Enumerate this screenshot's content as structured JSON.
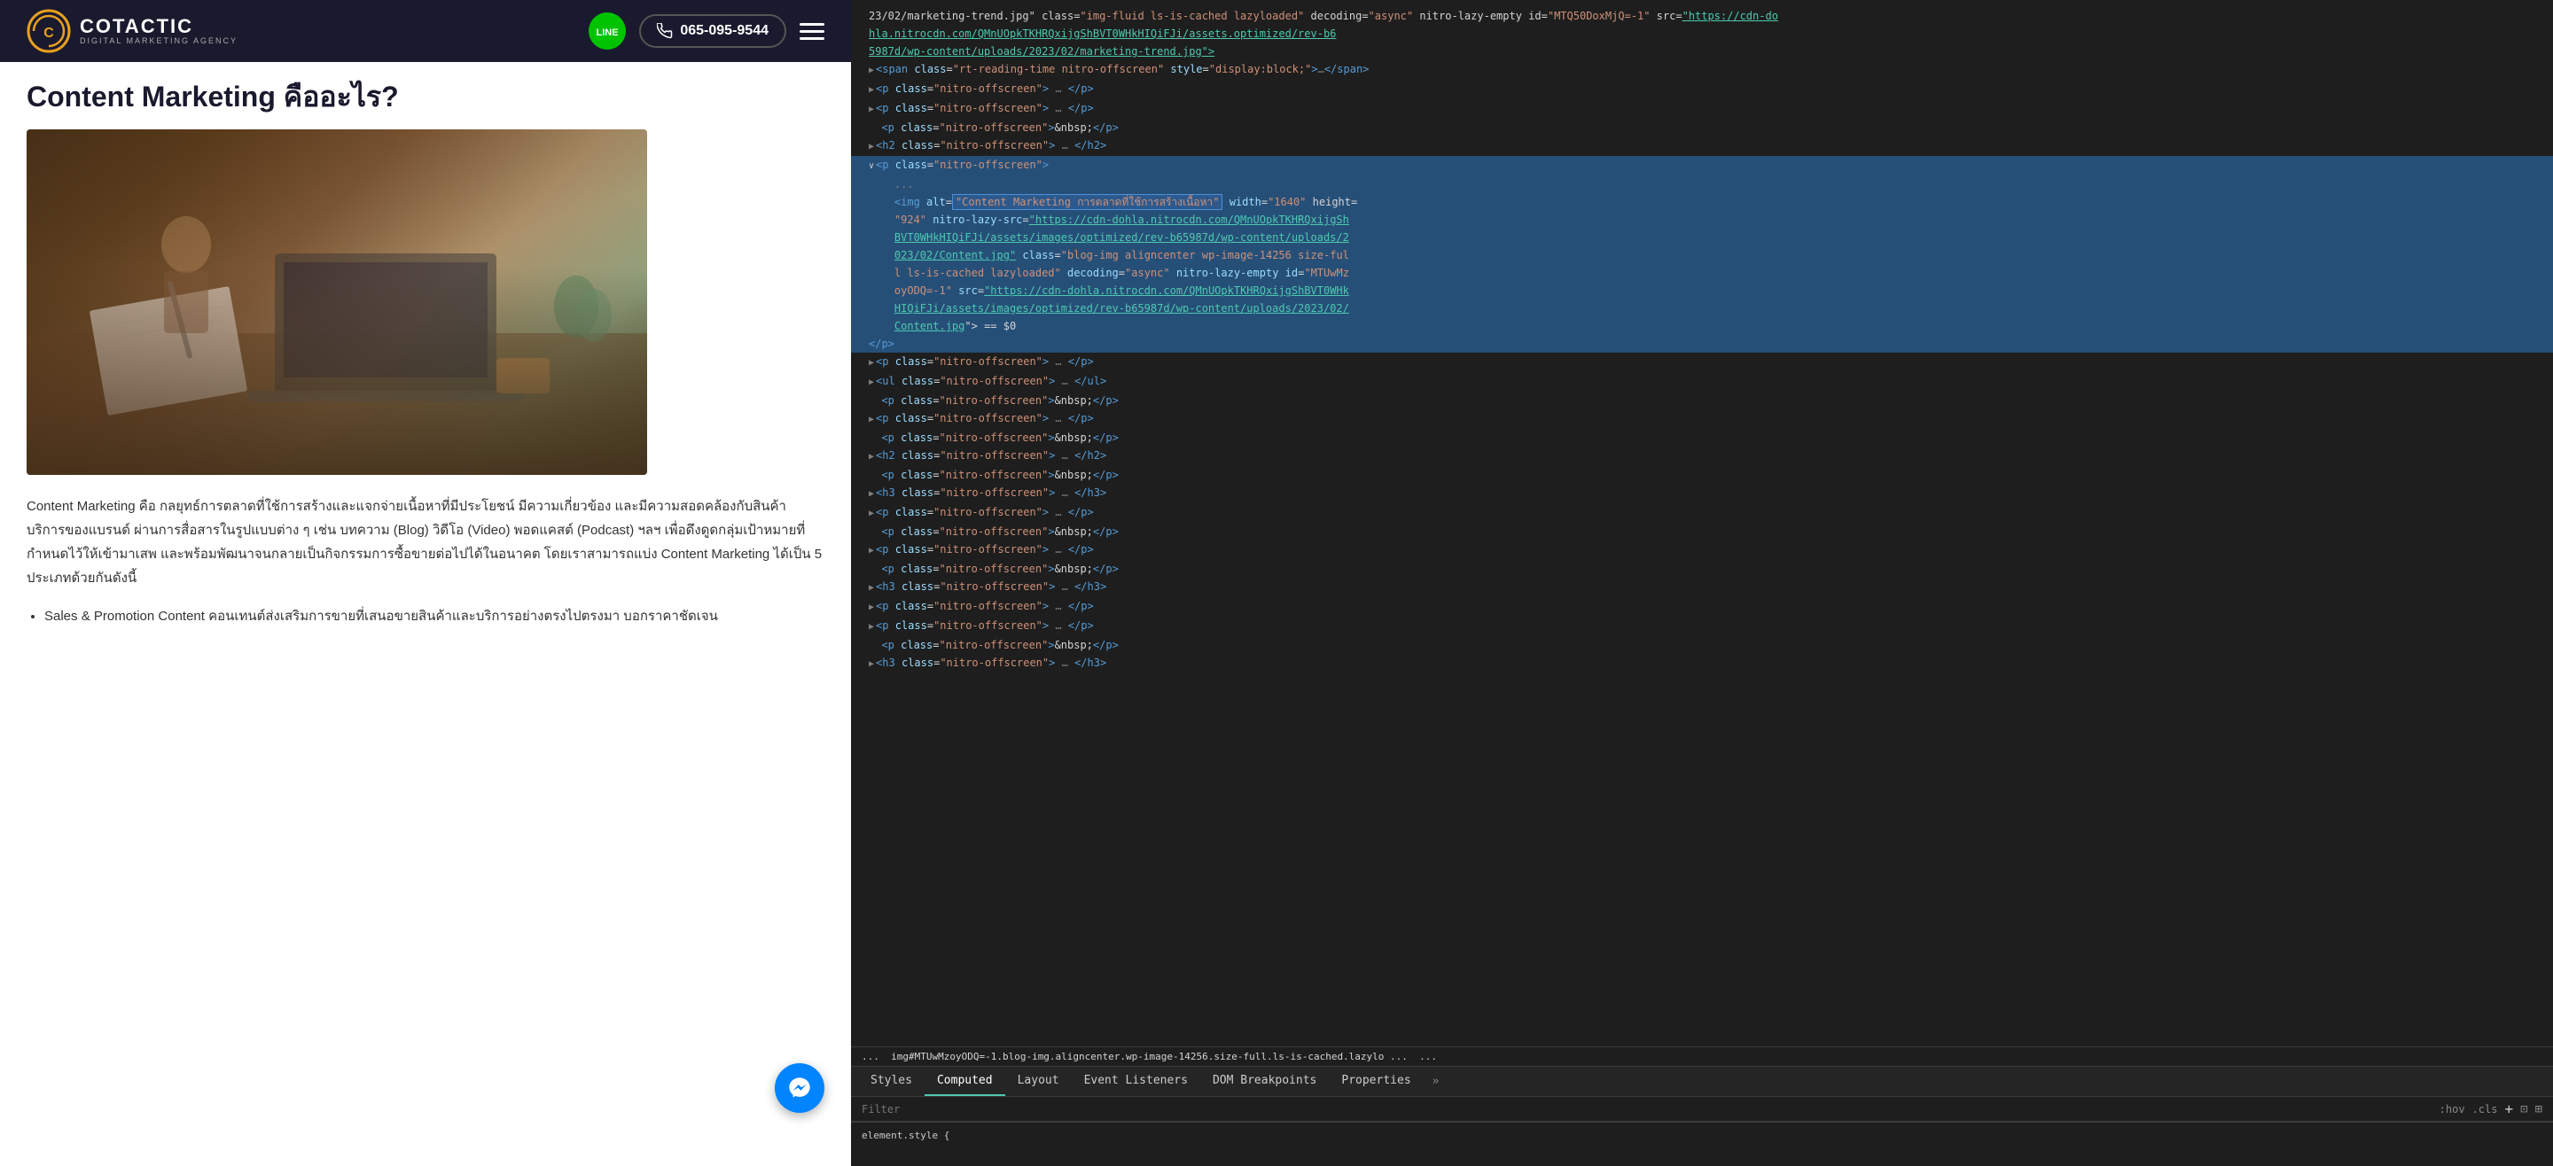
{
  "website": {
    "header": {
      "logo_text": "COTACTIC",
      "logo_sub": "DIGITAL MARKETING AGENCY",
      "phone": "065-095-9544",
      "line_icon": "L"
    },
    "page_title": "Content Marketing คืออะไร?",
    "hero_image_alt": "Content Marketing",
    "content_para": "Content Marketing คือ กลยุทธ์การตลาดที่ใช้การสร้างและแจกจ่ายเนื้อหาที่มีประโยชน์ มีความเกี่ยวข้อง และมีความสอดคล้องกับสินค้าบริการของแบรนด์ ผ่านการสื่อสารในรูปแบบต่าง ๆ เช่น บทความ (Blog) วิดีโอ (Video) พอดแคสต์ (Podcast) ฯลฯ เพื่อดึงดูดกลุ่มเป้าหมายที่กำหนดไว้ให้เข้ามาเสพ และพร้อมพัฒนาจนกลายเป็นกิจกรรมการซื้อขายต่อไปได้ในอนาคต โดยเราสามารถแบ่ง Content Marketing ได้เป็น 5 ประเภทด้วยกันดังนี้",
    "bullet_item": "Sales & Promotion Content คอนเทนต์ส่งเสริมการขายที่เสนอขายสินค้าและบริการอย่างตรงไปตรงมา บอกราคาชัดเจน"
  },
  "devtools": {
    "dom_lines": [
      {
        "id": 1,
        "indent": 0,
        "content": "23/02/marketing-trend.jpg\" class=\"img-fluid ls-is-cached lazyloaded\" decoding=\"async\" nitro-lazy-empty id=\"MTQ50DoxMjQ=-1\" src=\"https://cdn-do"
      },
      {
        "id": 2,
        "indent": 0,
        "content": "hla.nitrocdn.com/QMnUOpkTKHRQxijgShBVT0WHkHIQiFJi/assets.optimized/rev-b6"
      },
      {
        "id": 3,
        "indent": 0,
        "content": "5987d/wp-content/uploads/2023/02/marketing-trend.jpg\">"
      },
      {
        "id": 4,
        "indent": 0,
        "tag_open": "<span",
        "tag_attrs": " class=\"rt-reading-time nitro-offscreen\" style=\"display:block;\">",
        "ellipsis": "…",
        "tag_close": "</span>"
      },
      {
        "id": 5,
        "indent": 0,
        "tag_open": "▶ <p",
        "tag_attrs": " class=\"nitro-offscreen\">",
        "ellipsis": " … ",
        "tag_close": "</p>"
      },
      {
        "id": 6,
        "indent": 0,
        "tag_open": "▶ <p",
        "tag_attrs": " class=\"nitro-offscreen\">",
        "ellipsis": " … ",
        "tag_close": "</p>"
      },
      {
        "id": 7,
        "indent": 0,
        "content": "  <p class=\"nitro-offscreen\">&nbsp;</p>"
      },
      {
        "id": 8,
        "indent": 0,
        "tag_open": "▶ <h2",
        "tag_attrs": " class=\"nitro-offscreen\">",
        "ellipsis": " … ",
        "tag_close": "</h2>"
      },
      {
        "id": 9,
        "indent": 0,
        "tag_open": "∨ <p",
        "tag_attrs": " class=\"nitro-offscreen\">",
        "highlight": true
      },
      {
        "id": 10,
        "indent": 1,
        "content": "...",
        "is_dots": true
      },
      {
        "id": 11,
        "indent": 1,
        "is_highlighted_img": true,
        "img_alt_start": "<img alt=\"",
        "img_alt_text": "Content Marketing การตลาดที่ใช้การสร้างเนื้อหา",
        "img_alt_end": "\" width=\"1640\" height=",
        "img_rest": "\"924\" nitro-lazy-src=\"https://cdn-dohla.nitrocdn.com/QMnUOpkTKHRQxijgSh"
      },
      {
        "id": 12,
        "indent": 1,
        "content": "BVT0WHkHIQiFJi/assets/images/optimized/rev-b65987d/wp-content/uploads/2"
      },
      {
        "id": 13,
        "indent": 1,
        "content": "023/02/Content.jpg\" class=\"blog-img aligncenter wp-image-14256 size-ful"
      },
      {
        "id": 14,
        "indent": 1,
        "content": "l ls-is-cached lazyloaded\" decoding=\"async\" nitro-lazy-empty id=\"MTUwMz"
      },
      {
        "id": 15,
        "indent": 1,
        "content": "oyODQ=-1\" src=\"https://cdn-dohla.nitrocdn.com/QMnUOpkTKHRQxijgShBVT0WHk"
      },
      {
        "id": 16,
        "indent": 1,
        "content": "HIQiFJi/assets/images/optimized/rev-b65987d/wp-content/uploads/2023/02/"
      },
      {
        "id": 17,
        "indent": 1,
        "link_text": "Content.jpg",
        "link_suffix": "\"> == $0"
      },
      {
        "id": 18,
        "indent": 0,
        "tag_close_only": "</p>"
      },
      {
        "id": 19,
        "indent": 0,
        "tag_open": "▶ <p",
        "tag_attrs": " class=\"nitro-offscreen\">",
        "ellipsis": " … ",
        "tag_close": "</p>"
      },
      {
        "id": 20,
        "indent": 0,
        "tag_open": "▶ <ul",
        "tag_attrs": " class=\"nitro-offscreen\">",
        "ellipsis": " … ",
        "tag_close": "</ul>"
      },
      {
        "id": 21,
        "indent": 0,
        "content": "  <p class=\"nitro-offscreen\">&nbsp;</p>"
      },
      {
        "id": 22,
        "indent": 0,
        "tag_open": "▶ <p",
        "tag_attrs": " class=\"nitro-offscreen\">",
        "ellipsis": " … ",
        "tag_close": "</p>"
      },
      {
        "id": 23,
        "indent": 0,
        "content": "  <p class=\"nitro-offscreen\">&nbsp;</p>"
      },
      {
        "id": 24,
        "indent": 0,
        "tag_open": "▶ <h2",
        "tag_attrs": " class=\"nitro-offscreen\">",
        "ellipsis": " … ",
        "tag_close": "</h2>"
      },
      {
        "id": 25,
        "indent": 0,
        "content": "  <p class=\"nitro-offscreen\">&nbsp;</p>"
      },
      {
        "id": 26,
        "indent": 0,
        "tag_open": "▶ <h3",
        "tag_attrs": " class=\"nitro-offscreen\">",
        "ellipsis": " … ",
        "tag_close": "</h3>"
      },
      {
        "id": 27,
        "indent": 0,
        "tag_open": "▶ <p",
        "tag_attrs": " class=\"nitro-offscreen\">",
        "ellipsis": " … ",
        "tag_close": "</p>"
      },
      {
        "id": 28,
        "indent": 0,
        "content": "  <p class=\"nitro-offscreen\">&nbsp;</p>"
      },
      {
        "id": 29,
        "indent": 0,
        "tag_open": "▶ <p",
        "tag_attrs": " class=\"nitro-offscreen\">",
        "ellipsis": " … ",
        "tag_close": "</p>"
      },
      {
        "id": 30,
        "indent": 0,
        "content": "  <p class=\"nitro-offscreen\">&nbsp;</p>"
      },
      {
        "id": 31,
        "indent": 0,
        "tag_open": "▶ <h3",
        "tag_attrs": " class=\"nitro-offscreen\">",
        "ellipsis": " … ",
        "tag_close": "</h3>"
      },
      {
        "id": 32,
        "indent": 0,
        "tag_open": "▶ <p",
        "tag_attrs": " class=\"nitro-offscreen\">",
        "ellipsis": " … ",
        "tag_close": "</p>"
      },
      {
        "id": 33,
        "indent": 0,
        "tag_open": "▶ <p",
        "tag_attrs": " class=\"nitro-offscreen\">",
        "ellipsis": " … ",
        "tag_close": "</p>"
      },
      {
        "id": 34,
        "indent": 0,
        "content": "  <p class=\"nitro-offscreen\">&nbsp;</p>"
      },
      {
        "id": 35,
        "indent": 0,
        "tag_open": "▶ <h3",
        "tag_attrs": " class=\"nitro-offscreen\">",
        "ellipsis": " … ",
        "tag_close": "</h3>"
      }
    ],
    "breadcrumb": "img#MTUwMzoyODQ=-1.blog-img.aligncenter.wp-image-14256.size-full.ls-is-cached.lazylo ...",
    "tabs": [
      {
        "label": "Styles",
        "active": false
      },
      {
        "label": "Computed",
        "active": true
      },
      {
        "label": "Layout",
        "active": false
      },
      {
        "label": "Event Listeners",
        "active": false
      },
      {
        "label": "DOM Breakpoints",
        "active": false
      },
      {
        "label": "Properties",
        "active": false
      },
      {
        "label": "»",
        "active": false
      }
    ],
    "filter_placeholder": "Filter",
    "filter_controls": [
      ":hov",
      ".cls",
      "+",
      "⊡",
      "⊞"
    ]
  }
}
